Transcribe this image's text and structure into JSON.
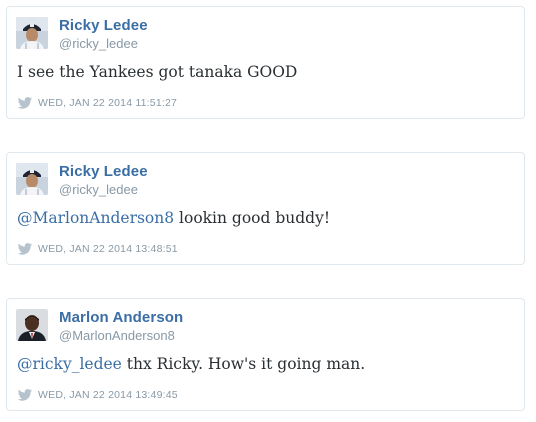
{
  "tweets": [
    {
      "name": "Ricky Ledee",
      "handle": "@ricky_ledee",
      "mention": "",
      "text": "I see the Yankees got tanaka GOOD",
      "timestamp": "WED, JAN 22 2014 11:51:27",
      "avatar": "ricky-ledee-avatar"
    },
    {
      "name": "Ricky Ledee",
      "handle": "@ricky_ledee",
      "mention": "@MarlonAnderson8",
      "text": " lookin good buddy!",
      "timestamp": "WED, JAN 22 2014 13:48:51",
      "avatar": "ricky-ledee-avatar"
    },
    {
      "name": "Marlon Anderson",
      "handle": "@MarlonAnderson8",
      "mention": "@ricky_ledee",
      "text": " thx Ricky. How's it going man.",
      "timestamp": "WED, JAN 22 2014 13:49:45",
      "avatar": "marlon-anderson-avatar"
    }
  ],
  "colors": {
    "link": "#3a6ea5",
    "muted": "#8899a6",
    "text": "#292f33",
    "border": "#e1e8ed"
  },
  "icons": {
    "timestamp_icon": "twitter-bird-icon"
  }
}
